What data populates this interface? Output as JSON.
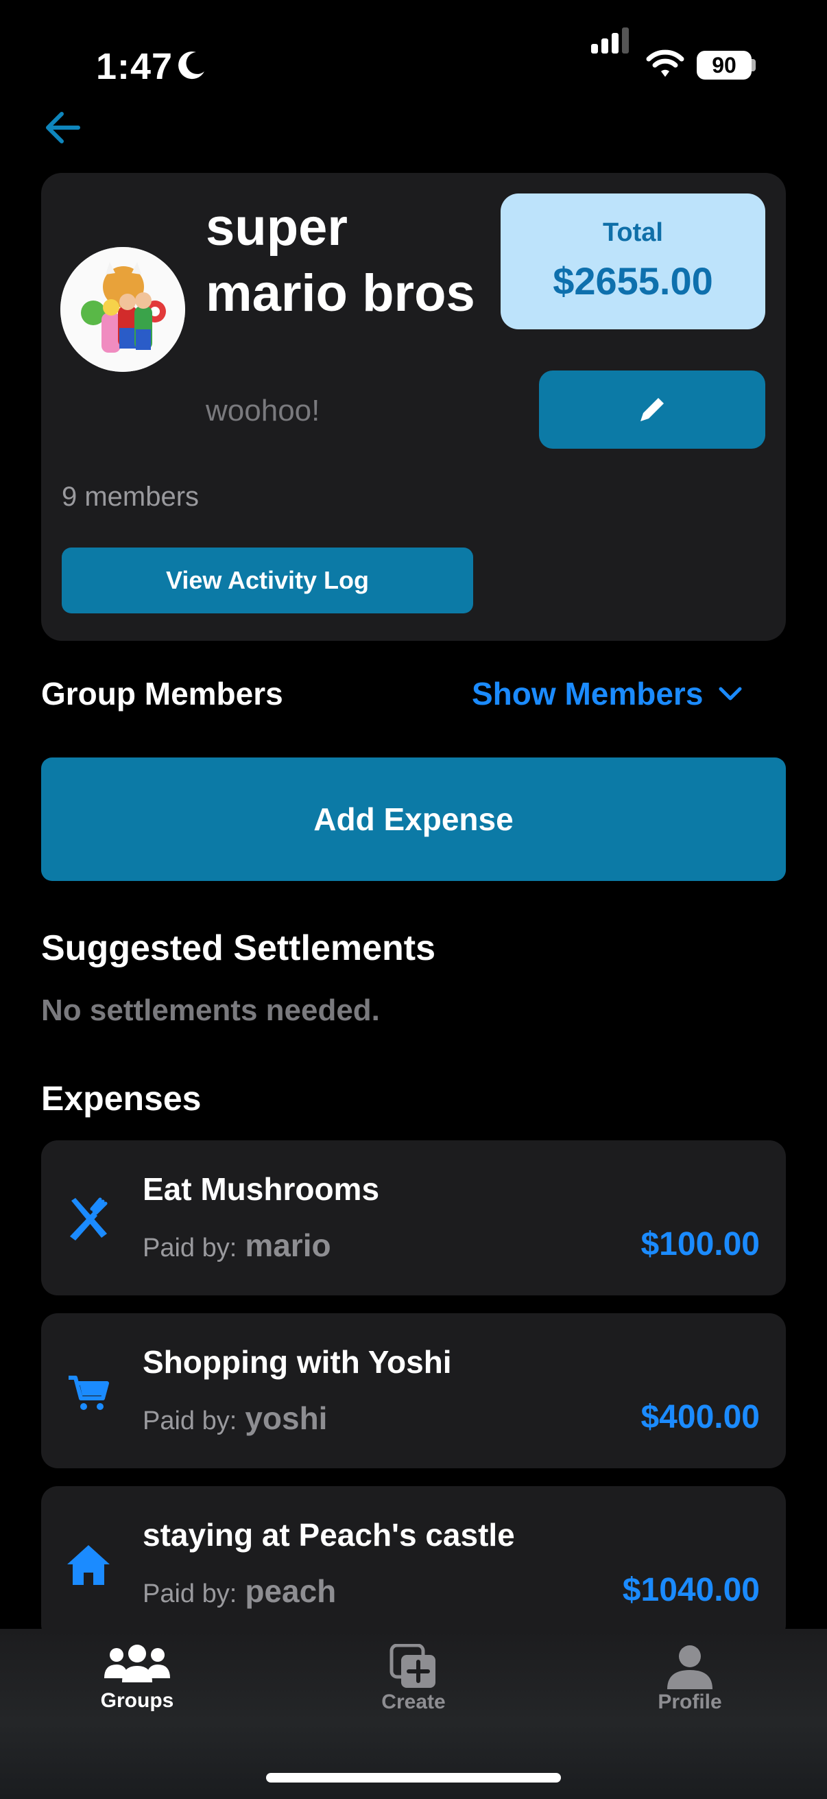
{
  "status_bar": {
    "time": "1:47",
    "battery": "90"
  },
  "group": {
    "name": "super mario bros",
    "description": "woohoo!",
    "member_count": "9 members",
    "total_label": "Total",
    "total_value": "$2655.00",
    "activity_button": "View Activity Log"
  },
  "members_section": {
    "title": "Group Members",
    "toggle_label": "Show Members"
  },
  "add_expense_label": "Add Expense",
  "settlements": {
    "title": "Suggested Settlements",
    "empty_text": "No settlements needed."
  },
  "expenses": {
    "title": "Expenses",
    "paid_by_label": "Paid by:",
    "items": [
      {
        "title": "Eat Mushrooms",
        "payer": "mario",
        "amount": "$100.00",
        "icon": "fork-knife-icon"
      },
      {
        "title": "Shopping with Yoshi",
        "payer": "yoshi",
        "amount": "$400.00",
        "icon": "cart-icon"
      },
      {
        "title": "staying at Peach's castle",
        "payer": "peach",
        "amount": "$1040.00",
        "icon": "house-icon"
      }
    ]
  },
  "tabs": [
    {
      "label": "Groups",
      "icon": "people-icon",
      "active": true
    },
    {
      "label": "Create",
      "icon": "create-icon",
      "active": false
    },
    {
      "label": "Profile",
      "icon": "person-icon",
      "active": false
    }
  ],
  "colors": {
    "accent": "#0c7aa6",
    "link": "#1b8bff",
    "total_bg": "#bde3fb",
    "card": "#1c1c1e"
  }
}
